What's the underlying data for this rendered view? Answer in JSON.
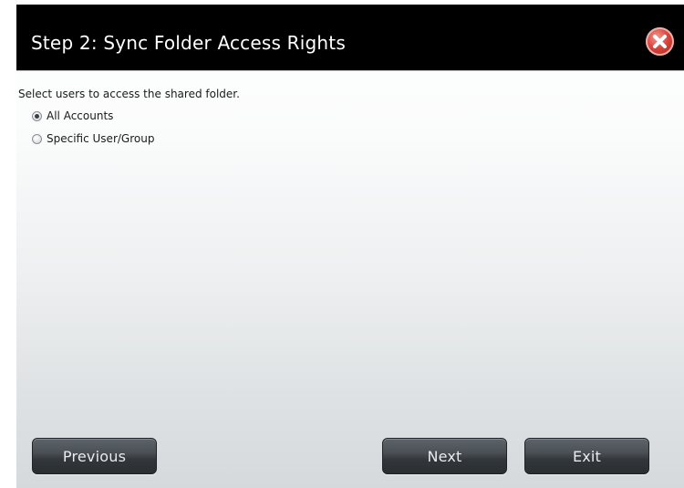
{
  "dialog": {
    "title": "Step 2: Sync Folder Access Rights",
    "close_icon": "close-icon",
    "colors": {
      "titlebar": "#000000",
      "title_text": "#ffffff",
      "close_button": "#d9433a",
      "button_bg": "#3a4045",
      "button_text": "#e9ecee"
    }
  },
  "content": {
    "instruction": "Select users to access the shared folder.",
    "options": [
      {
        "label": "All Accounts",
        "checked": true
      },
      {
        "label": "Specific User/Group",
        "checked": false
      }
    ]
  },
  "buttons": {
    "previous": "Previous",
    "next": "Next",
    "exit": "Exit"
  }
}
